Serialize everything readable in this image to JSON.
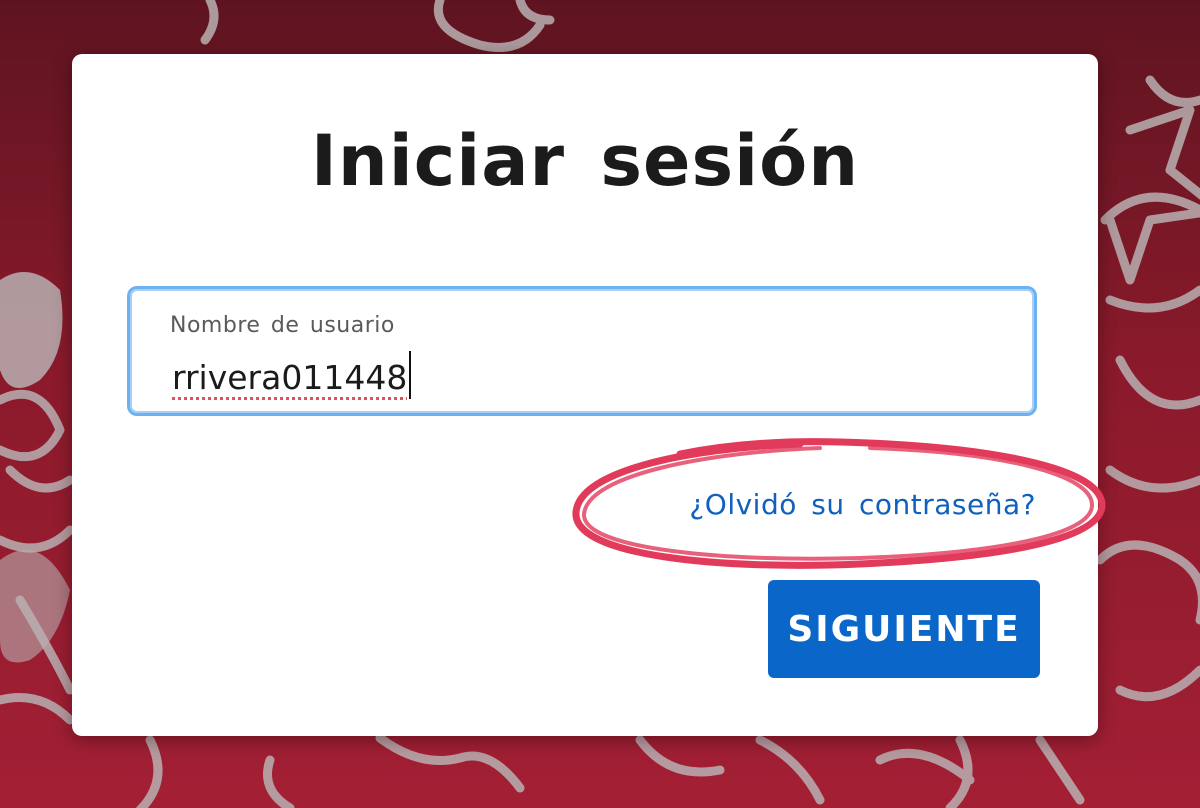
{
  "login": {
    "title": "Iniciar sesión",
    "username_label": "Nombre de usuario",
    "username_value": "rrivera011448",
    "forgot_password_link": "¿Olvidó su contraseña?",
    "next_button": "SIGUIENTE"
  },
  "colors": {
    "background_top": "#5e1420",
    "background_bottom": "#a31f34",
    "card": "#ffffff",
    "field_focus_border": "#6cb2f2",
    "link": "#1060c0",
    "primary_button": "#0a67c9",
    "annotation": "#e23a5a"
  }
}
